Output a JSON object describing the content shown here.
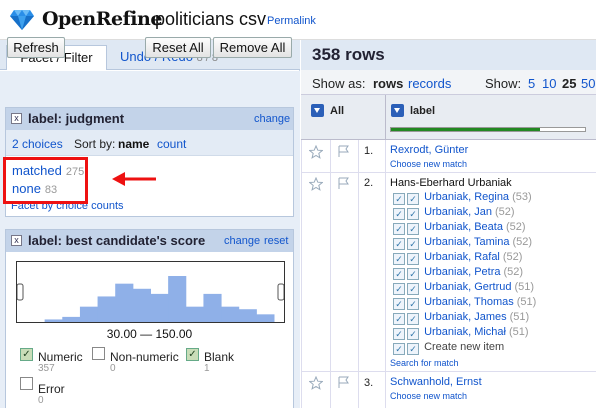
{
  "header": {
    "app_name": "OpenRefine",
    "project_name": "politicians csv",
    "permalink": "Permalink"
  },
  "left_tabs": {
    "facet_filter": "Facet / Filter",
    "undo_redo": "Undo / Redo",
    "undo_count": "8 / 8"
  },
  "toolbar": {
    "refresh": "Refresh",
    "reset_all": "Reset All",
    "remove_all": "Remove All"
  },
  "facet1": {
    "close": "x",
    "title": "label: judgment",
    "change": "change",
    "choices_summary": "2 choices",
    "sort_by": "Sort by:",
    "sort_name": "name",
    "sort_count": "count",
    "choices": [
      {
        "label": "matched",
        "count": "275"
      },
      {
        "label": "none",
        "count": "83"
      }
    ],
    "footer": "Facet by choice counts"
  },
  "facet2": {
    "close": "x",
    "title": "label: best candidate's score",
    "change": "change",
    "reset": "reset",
    "histogram_bins": [
      0,
      1,
      2,
      6,
      10,
      15,
      13,
      11,
      18,
      6,
      11,
      6,
      5,
      3
    ],
    "range": "30.00 — 150.00",
    "checks": [
      {
        "label": "Numeric",
        "count": "357",
        "checked": true
      },
      {
        "label": "Non-numeric",
        "count": "0",
        "checked": false
      },
      {
        "label": "Blank",
        "count": "1",
        "checked": true
      },
      {
        "label": "Error",
        "count": "0",
        "checked": false
      }
    ]
  },
  "grid": {
    "rows_title": "358 rows",
    "show_as": "Show as:",
    "rows_mode": "rows",
    "records_mode": "records",
    "show": "Show:",
    "page_sizes": [
      "5",
      "10",
      "25",
      "50"
    ],
    "active_page_size": "25",
    "col_all": "All",
    "col_label": "label",
    "match_progress": 0.77,
    "rows": [
      {
        "num": "1.",
        "value": "Rexrodt, Günter",
        "link": "Choose new match"
      },
      {
        "num": "2.",
        "value": "Hans-Eberhard Urbaniak",
        "candidates": [
          {
            "name": "Urbaniak, Regina",
            "score": "(53)"
          },
          {
            "name": "Urbaniak, Jan",
            "score": "(52)"
          },
          {
            "name": "Urbaniak, Beata",
            "score": "(52)"
          },
          {
            "name": "Urbaniak, Tamina",
            "score": "(52)"
          },
          {
            "name": "Urbaniak, Rafal",
            "score": "(52)"
          },
          {
            "name": "Urbaniak, Petra",
            "score": "(52)"
          },
          {
            "name": "Urbaniak, Gertrud",
            "score": "(51)"
          },
          {
            "name": "Urbaniak, Thomas",
            "score": "(51)"
          },
          {
            "name": "Urbaniak, James",
            "score": "(51)"
          },
          {
            "name": "Urbaniak, Michał",
            "score": "(51)"
          }
        ],
        "create_new": "Create new item",
        "search": "Search for match"
      },
      {
        "num": "3.",
        "value": "Schwanhold, Ernst",
        "link": "Choose new match"
      }
    ]
  },
  "colors": {
    "accent_link": "#1155cc",
    "panel_blue": "#e7eef7",
    "header_blue": "#c3d3e9",
    "highlight_red": "#ee1111",
    "progress_green": "#228822",
    "hist_bar": "#8fb0e8"
  }
}
